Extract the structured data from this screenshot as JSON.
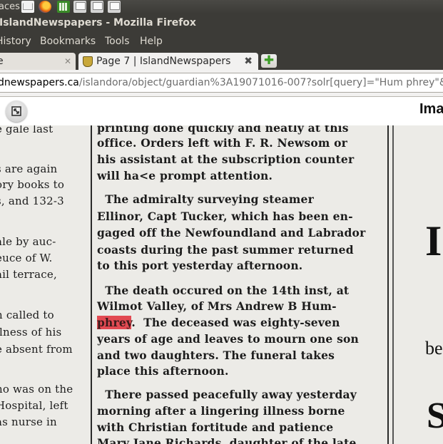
{
  "panel": {
    "workspace_text": "aces"
  },
  "window": {
    "title": "IslandNewspapers - Mozilla Firefox"
  },
  "menu": {
    "history": "History",
    "bookmarks": "Bookmarks",
    "tools": "Tools",
    "help": "Help"
  },
  "tabs": [
    {
      "label": "e",
      "close": "✕"
    },
    {
      "label": "Page 7 | IslandNewspapers",
      "close": "✖"
    }
  ],
  "newtab": "✚",
  "url": {
    "host": "dnewspapers.ca",
    "path": "/islandora/object/guardian%3A19071016-007?solr[query]=\"Hum phrey\"&solr["
  },
  "viewer": {
    "heading_fragment": "Ima"
  },
  "newspaper": {
    "left_column": [
      "e gale last",
      "",
      "s are again",
      "ory books to",
      "s, and 132-3",
      "",
      "ale by auc-",
      "euce of W.",
      "ail terrace,",
      "",
      "n called to",
      "llness of his",
      "e absent from",
      "",
      "no was on the",
      "Hospital, left",
      "as nurse in"
    ],
    "middle_column": [
      "printing done quickly and neatly at this",
      "office. Orders left with F. R. Newsom or",
      "his assistant at the subscription counter",
      "will ha<e prompt attention.",
      "  The admiralty surveying steamer",
      "Ellinor, Capt Tucker, which has been en-",
      "gaged off the Newfoundland and Labrador",
      "coasts during the past summer returned",
      "to this port yesterday afternoon.",
      "  The death occured on the 14th inst, at",
      "Wilmot Valley, of Mrs Andrew B Hum-",
      "phrey",
      ".  The deceased was eighty-seven",
      "years of age and leaves to mourn one son",
      "and two daughters. The funeral takes",
      "place this afternoon.",
      "  There passed peacefully away yesterday",
      "morning after a lingering illness borne",
      "with Christian fortitude and patience",
      "Mary Jane Richards, daughter of the late"
    ],
    "right_column": [
      "I",
      "be",
      "S"
    ]
  }
}
